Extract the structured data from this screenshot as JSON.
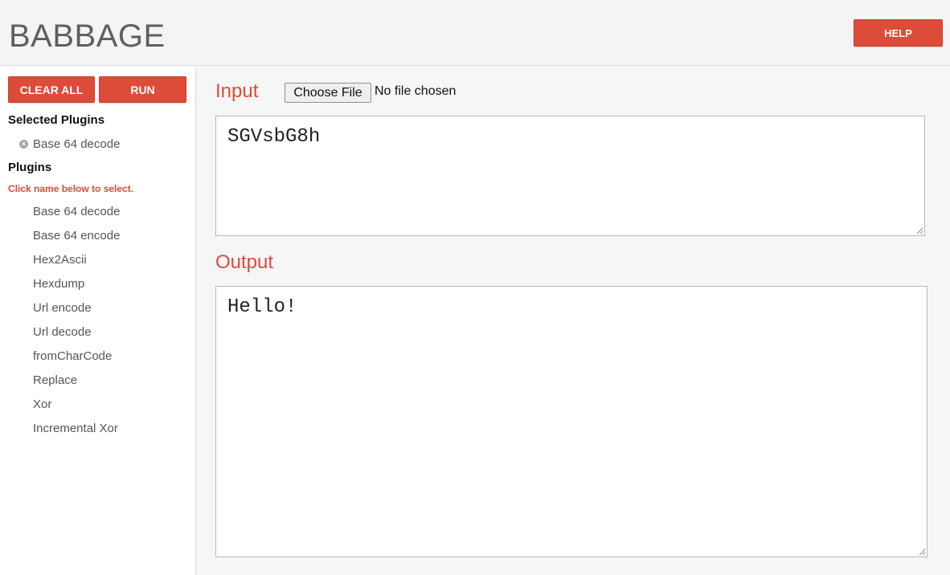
{
  "app": {
    "title": "BABBAGE"
  },
  "header": {
    "help_label": "HELP"
  },
  "sidebar": {
    "clear_all_label": "CLEAR ALL",
    "run_label": "RUN",
    "selected_heading": "Selected Plugins",
    "selected_plugins": [
      "Base 64 decode"
    ],
    "plugins_heading": "Plugins",
    "hint": "Click name below to select.",
    "plugins": [
      "Base 64 decode",
      "Base 64 encode",
      "Hex2Ascii",
      "Hexdump",
      "Url encode",
      "Url decode",
      "fromCharCode",
      "Replace",
      "Xor",
      "Incremental Xor"
    ]
  },
  "main": {
    "input_title": "Input",
    "file_button_label": "Choose File",
    "file_status": "No file chosen",
    "input_value": "SGVsbG8h",
    "output_title": "Output",
    "output_value": "Hello!"
  },
  "colors": {
    "accent": "#dd4b39",
    "logo": "#5f5f5f",
    "background": "#f6f6f6"
  },
  "icons": {
    "remove_selected": "close-circle-icon",
    "resize": "resize-grip-icon"
  }
}
